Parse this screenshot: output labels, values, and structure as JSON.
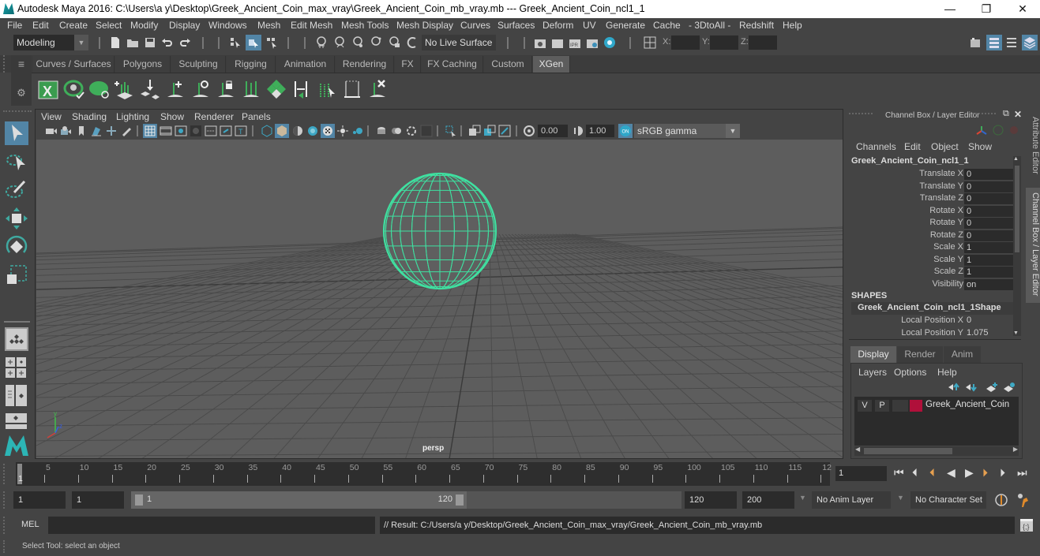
{
  "window": {
    "title": "Autodesk Maya 2016: C:\\Users\\a y\\Desktop\\Greek_Ancient_Coin_max_vray\\Greek_Ancient_Coin_mb_vray.mb   ---   Greek_Ancient_Coin_ncl1_1",
    "minimize": "—",
    "maximize": "❐",
    "close": "✕"
  },
  "menubar": [
    "File",
    "Edit",
    "Create",
    "Select",
    "Modify",
    "Display",
    "Windows",
    "Mesh",
    "Edit Mesh",
    "Mesh Tools",
    "Mesh Display",
    "Curves",
    "Surfaces",
    "Deform",
    "UV",
    "Generate",
    "Cache",
    "- 3DtoAll -",
    "Redshift",
    "Help"
  ],
  "statusline": {
    "mode": "Modeling",
    "live_surface": "No Live Surface",
    "x_label": "X:",
    "y_label": "Y:",
    "z_label": "Z:"
  },
  "shelf": {
    "tabs": [
      "Curves / Surfaces",
      "Polygons",
      "Sculpting",
      "Rigging",
      "Animation",
      "Rendering",
      "FX",
      "FX Caching",
      "Custom",
      "XGen"
    ],
    "active_tab": "XGen"
  },
  "viewport": {
    "menu": [
      "View",
      "Shading",
      "Lighting",
      "Show",
      "Renderer",
      "Panels"
    ],
    "exposure": "0.00",
    "gamma": "1.00",
    "color_space": "sRGB gamma",
    "camera": "persp",
    "axis": {
      "x": "x",
      "y": "y",
      "z": "z"
    },
    "colors": {
      "wireframe": "#3fe0a0"
    }
  },
  "channel_box": {
    "header": "Channel Box / Layer Editor",
    "menu": [
      "Channels",
      "Edit",
      "Object",
      "Show"
    ],
    "object": "Greek_Ancient_Coin_ncl1_1",
    "channels": [
      {
        "label": "Translate X",
        "value": "0"
      },
      {
        "label": "Translate Y",
        "value": "0"
      },
      {
        "label": "Translate Z",
        "value": "0"
      },
      {
        "label": "Rotate X",
        "value": "0"
      },
      {
        "label": "Rotate Y",
        "value": "0"
      },
      {
        "label": "Rotate Z",
        "value": "0"
      },
      {
        "label": "Scale X",
        "value": "1"
      },
      {
        "label": "Scale Y",
        "value": "1"
      },
      {
        "label": "Scale Z",
        "value": "1"
      },
      {
        "label": "Visibility",
        "value": "on"
      }
    ],
    "shapes_header": "SHAPES",
    "shape_name": "Greek_Ancient_Coin_ncl1_1Shape",
    "shape_channels": [
      {
        "label": "Local Position X",
        "value": "0"
      },
      {
        "label": "Local Position Y",
        "value": "1.075"
      }
    ]
  },
  "layer_editor": {
    "tabs": [
      "Display",
      "Render",
      "Anim"
    ],
    "active_tab": "Display",
    "menu": [
      "Layers",
      "Options",
      "Help"
    ],
    "layers": [
      {
        "v": "V",
        "p": "P",
        "name": "Greek_Ancient_Coin",
        "color": "#b0103a"
      }
    ]
  },
  "side_tabs": [
    "Attribute Editor",
    "Channel Box / Layer Editor"
  ],
  "timeline": {
    "ticks": [
      "5",
      "10",
      "15",
      "20",
      "25",
      "30",
      "35",
      "40",
      "45",
      "50",
      "55",
      "60",
      "65",
      "70",
      "75",
      "80",
      "85",
      "90",
      "95",
      "100",
      "105",
      "110",
      "115",
      "12"
    ],
    "current_marker": "1",
    "current_frame": "1"
  },
  "range": {
    "start": "1",
    "playback_start": "1",
    "range_min": "1",
    "range_max": "120",
    "playback_end": "120",
    "end": "200",
    "anim_layer": "No Anim Layer",
    "character_set": "No Character Set"
  },
  "command": {
    "lang": "MEL",
    "input": "",
    "result": "// Result: C:/Users/a y/Desktop/Greek_Ancient_Coin_max_vray/Greek_Ancient_Coin_mb_vray.mb"
  },
  "help_line": "Select Tool: select an object"
}
